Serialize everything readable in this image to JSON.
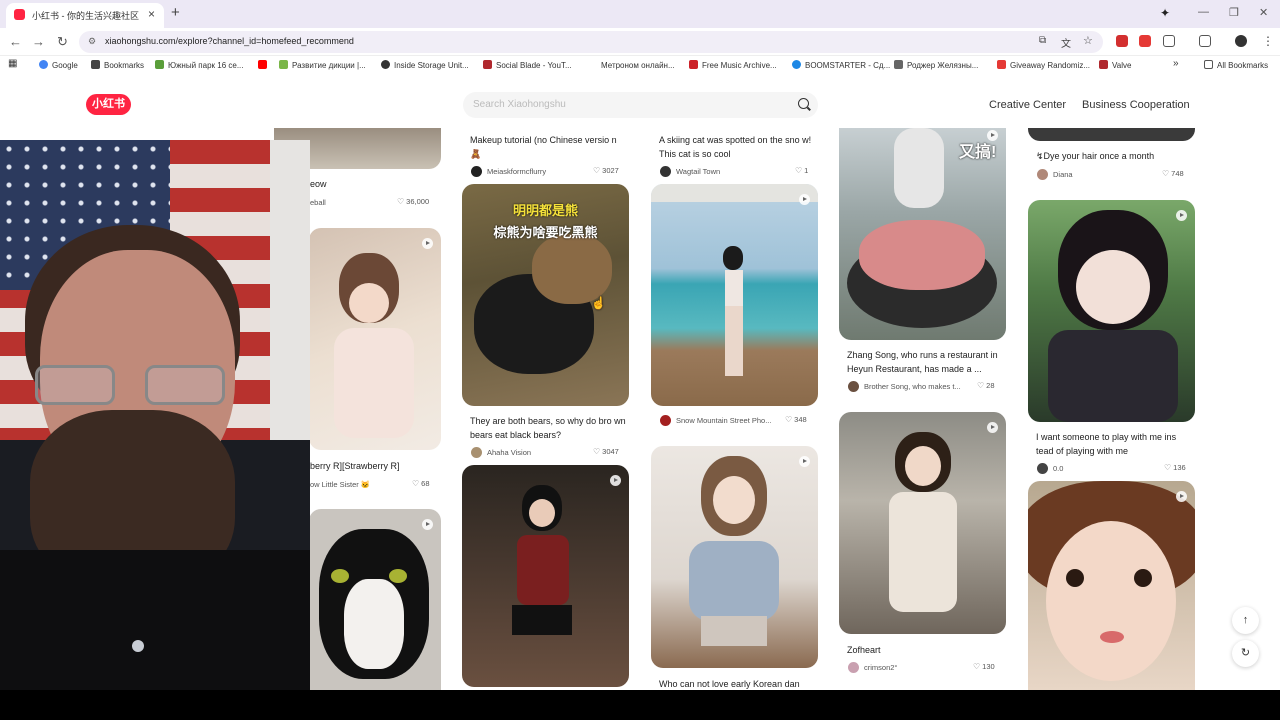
{
  "browser": {
    "tab_title": "小红书 - 你的生活兴趣社区",
    "url": "xiaohongshu.com/explore?channel_id=homefeed_recommend",
    "bookmarks": [
      {
        "label": "Google",
        "color": "#4285f4"
      },
      {
        "label": "Bookmarks",
        "color": "#444"
      },
      {
        "label": "Южный парк 16 се...",
        "color": "#5a9e3a"
      },
      {
        "label": "",
        "color": "#ff0000"
      },
      {
        "label": "Развитие дикции |...",
        "color": "#7ab648"
      },
      {
        "label": "Inside Storage Unit...",
        "color": "#333"
      },
      {
        "label": "Social Blade - YouT...",
        "color": "#b0282e"
      },
      {
        "label": "Метроном онлайн...",
        "color": "#fff"
      },
      {
        "label": "Free Music Archive...",
        "color": "#cc2229"
      },
      {
        "label": "BOOMSTARTER - Сд...",
        "color": "#1e88e5"
      },
      {
        "label": "Роджер Желязны...",
        "color": "#666"
      },
      {
        "label": "Giveaway Randomiz...",
        "color": "#e53935"
      },
      {
        "label": "Valve",
        "color": "#b0282e"
      }
    ],
    "all_bookmarks": "All Bookmarks"
  },
  "header": {
    "logo": "小红书",
    "search_placeholder": "Search Xiaohongshu",
    "links": [
      "Creative Center",
      "Business Cooperation"
    ]
  },
  "cards": [
    {
      "id": "c1",
      "title": "eow",
      "author": "eball",
      "likes": "36,000"
    },
    {
      "id": "c2",
      "title": "berry R][Strawberry R]",
      "author": "ow Little Sister 🐱",
      "likes": "68"
    },
    {
      "id": "c3",
      "title": "Makeup tutorial (no Chinese versio n🧸",
      "author": "Meiaskformcflurry",
      "likes": "3027"
    },
    {
      "id": "c4",
      "title": "They are both bears, so why do bro wn bears eat black bears?",
      "author": "Ahaha Vision",
      "likes": "3047",
      "overlay_line1": "明明都是熊",
      "overlay_line2": "棕熊为啥要吃黑熊"
    },
    {
      "id": "c5",
      "title": "A skiing cat was spotted on the sno w! This cat is so cool",
      "author": "Wagtail Town",
      "likes": "1"
    },
    {
      "id": "c6",
      "title": "",
      "author": "Snow Mountain Street Pho...",
      "likes": "348"
    },
    {
      "id": "c7",
      "title": "Who can not love early Korean dan",
      "author": "",
      "likes": ""
    },
    {
      "id": "c8",
      "title": "Zhang Song, who runs a restaurant in Heyun Restaurant, has made a ...",
      "author": "Brother Song, who makes t...",
      "likes": "28",
      "overlay": "又搞!"
    },
    {
      "id": "c9",
      "title": "Zofheart",
      "author": "crimson2°",
      "likes": "130"
    },
    {
      "id": "c10",
      "title": "↯Dye your hair once a month",
      "author": "Diana",
      "likes": "748"
    },
    {
      "id": "c11",
      "title": "I want someone to play with me ins tead of playing with me",
      "author": "0.0",
      "likes": "136"
    }
  ]
}
